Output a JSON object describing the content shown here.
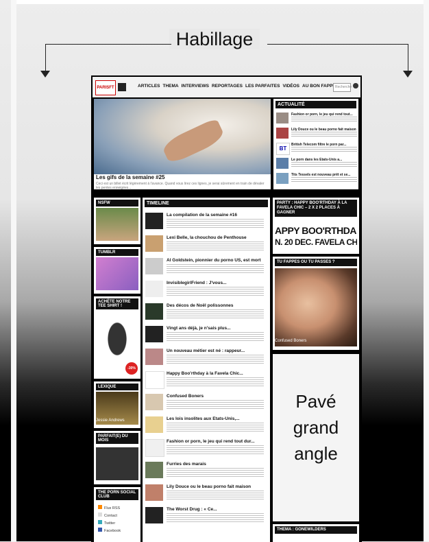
{
  "header": {
    "title": "Habillage"
  },
  "site": {
    "logo": "PARISFT",
    "nav": [
      "ARTICLES",
      "THEMA",
      "INTERVIEWS",
      "REPORTAGES",
      "LES PARFAITES",
      "VIDÉOS",
      "AU BON FAPPEUR"
    ],
    "search_placeholder": "Recherche",
    "hero": {
      "title": "Les gifs de la semaine #25",
      "text": "Ceci est un billet écrit légèrement à l'avance. Quand vous lirez ces lignes, je serai sûrement en train de dévaler les pentes enneigées..."
    },
    "actualite": {
      "heading": "ACTUALITÉ",
      "items": [
        "Fashion or porn, le jeu qui rend tout...",
        "Lily Douce ou le beau porno fait maison",
        "British Telecom filtre le porn par...",
        "Le porn dans les Etats-Unis a...",
        "Tits Tessels est nouveau prêt et se..."
      ]
    },
    "left": {
      "nsfw": "NSFW",
      "tumblr": "TUMBLR",
      "tee": "ACHÈTE NOTRE TEE SHIRT !",
      "tee_badge": "-30%",
      "lexique": "LEXIQUE",
      "lexique_caption": "Jessie Andrews",
      "parfaite": "PARFAIT(E) DU MOIS",
      "club": "THE PORN SOCIAL CLUB",
      "social": [
        "Flux RSS",
        "Contact",
        "Twitter",
        "Facebook"
      ]
    },
    "timeline": {
      "heading": "TIMELINE",
      "items": [
        "La compilation de la semaine #16",
        "Lexi Belle, la chouchou de Penthouse",
        "Al Goldstein, pionnier du porno US, est mort",
        "InvisiblegirlFriend : J'vous...",
        "Des décos de Noël polissonnes",
        "Vingt ans déjà, je n'sais plus...",
        "Un nouveau métier est né : rappeur...",
        "Happy Boo'rthday à la Favela Chic...",
        "Confused Boners",
        "Les lois insolites aux Etats-Unis,...",
        "Fashion or porn, le jeu qui rend tout dur...",
        "Furries des marais",
        "Lily Douce ou le beau porno fait maison",
        "The Worst Drug : « Ce..."
      ]
    },
    "right": {
      "party_heading": "PARTY : HAPPY BOO'RTHDAY À LA FAVELA CHIC – 2 X 2 PLACES À GAGNER",
      "party_line1": "APPY BOO'RTHDA",
      "party_line2": "N. 20 DEC. FAVELA CHI",
      "fappes_heading": "TU FAPPES OU TU PASSES ?",
      "fappes_caption": "Confused Boners",
      "pave_label": "Pavé grand angle",
      "thema_heading": "THEMA : GONEWILDERS"
    }
  }
}
